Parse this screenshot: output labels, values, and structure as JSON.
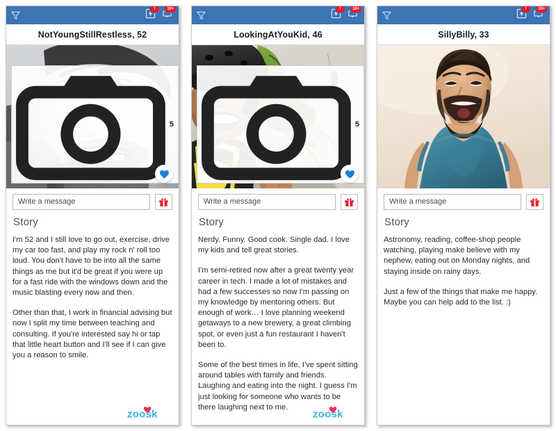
{
  "colors": {
    "appbar_blue": "#3c74b4",
    "badge_red": "#e8192c",
    "heart_blue": "#1e7fd4",
    "gift_red": "#ec1c24",
    "zoosk_blue": "#3bb3e4",
    "zoosk_heart": "#e8325a",
    "card_border": "#c9c9c9",
    "story_text": "#2b2b2b"
  },
  "icons": {
    "filter": "filter-funnel-icon",
    "boost": "lightning-bolt-icon",
    "messages": "chat-bubble-icon",
    "camera": "camera-icon",
    "heart": "heart-icon",
    "gift": "gift-icon",
    "logo": "zoosk-logo"
  },
  "appbar": {
    "boost_badge": "!",
    "messages_badge": "10+"
  },
  "common": {
    "message_placeholder": "Write a message",
    "message_value": "",
    "story_heading": "Story",
    "logo_text": "zoosk"
  },
  "cards": [
    {
      "username": "NotYoungStillRestless, 52",
      "photo_count": "5",
      "has_photo_count": true,
      "has_heart": true,
      "heart_state": "liked",
      "photo_alt": "black-and-white close-up selfie of a smiling bearded man",
      "story": [
        "I'm 52 and I still love to go out, exercise, drive my car too fast, and play my  rock n' roll too loud. You don't have to be into all the same things as me but it'd be great if you were up for a fast ride with the windows down and the music blasting every now and then.",
        "Other than that, I work in financial advising but now I split my time between teaching and consulting. If you're interested say hi or tap that little heart button and I'll see if I can give you a reason to smile."
      ]
    },
    {
      "username": "LookingAtYouKid, 46",
      "photo_count": "5",
      "has_photo_count": true,
      "has_heart": true,
      "heart_state": "liked",
      "photo_alt": "smiling man in a black climbing helmet and yellow jacket giving a thumbs up on a rocky cliff",
      "story": [
        "Nerdy. Funny. Good cook. Single dad. I love my kids and tell great stories.",
        "I'm semi-retired now after a great twenty year career in tech. I made a lot of mistakes and had a few successes so now I'm passing on my knowledge by mentoring others. But enough of work… I love planning weekend getaways to a new brewery, a great climbing spot, or even just a fun restaurant I haven't been to.",
        "Some of the best times in life, I've spent sitting around tables with family and friends. Laughing and eating into the night. I guess I'm just looking for someone who wants to be there laughing next to me."
      ]
    },
    {
      "username": "SillyBilly, 33",
      "photo_count": "",
      "has_photo_count": false,
      "has_heart": false,
      "heart_state": "none",
      "photo_alt": "laughing man with beard wearing a teal v-neck t-shirt against a cream wall",
      "story": [
        "Astronomy, reading, coffee-shop people watching, playing make believe with my nephew, eating out on Monday nights, and staying inside on rainy days.",
        "Just a few of the things that make me happy. Maybe you can help add to the list.  :)"
      ]
    }
  ]
}
